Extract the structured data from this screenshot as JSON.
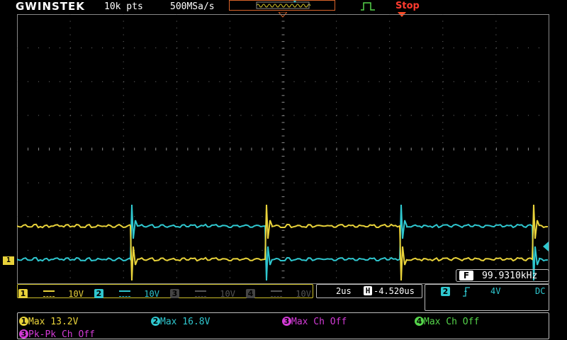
{
  "header": {
    "brand": "GWINSTEK",
    "record_length": "10k pts",
    "sample_rate": "500MSa/s",
    "trigger_type_icon": "edge-pulse-icon",
    "run_state": "Stop"
  },
  "frequency": {
    "label": "F",
    "value": "99.9310kHz"
  },
  "channels": [
    {
      "num": "1",
      "coupling_icon": "dc-coupling-icon",
      "scale": "10V",
      "color": "#e8d23a"
    },
    {
      "num": "2",
      "coupling_icon": "dc-coupling-icon",
      "scale": "10V",
      "color": "#2fc7cf"
    },
    {
      "num": "3",
      "coupling_icon": "dc-coupling-icon",
      "scale": "10V",
      "color": "#5a5a5a"
    },
    {
      "num": "4",
      "coupling_icon": "dc-coupling-icon",
      "scale": "10V",
      "color": "#5a5a5a"
    }
  ],
  "timebase": {
    "scale": "2us",
    "position_label": "H",
    "position": "-4.520us"
  },
  "trigger": {
    "source": "2",
    "slope_icon": "rising-edge-icon",
    "level": "4V",
    "coupling": "DC"
  },
  "ground_marker": "1",
  "measurements": [
    {
      "badge": "1",
      "text": "Max 13.2V",
      "color": "#e8d23a"
    },
    {
      "badge": "2",
      "text": "Max 16.8V",
      "color": "#2fc7cf"
    },
    {
      "badge": "3",
      "text": "Max Ch Off",
      "color": "#d33bd6"
    },
    {
      "badge": "4",
      "text": "Max Ch Off",
      "color": "#55d44a"
    },
    {
      "badge": "3",
      "text": "Pk-Pk Ch Off",
      "color": "#d33bd6"
    }
  ]
}
